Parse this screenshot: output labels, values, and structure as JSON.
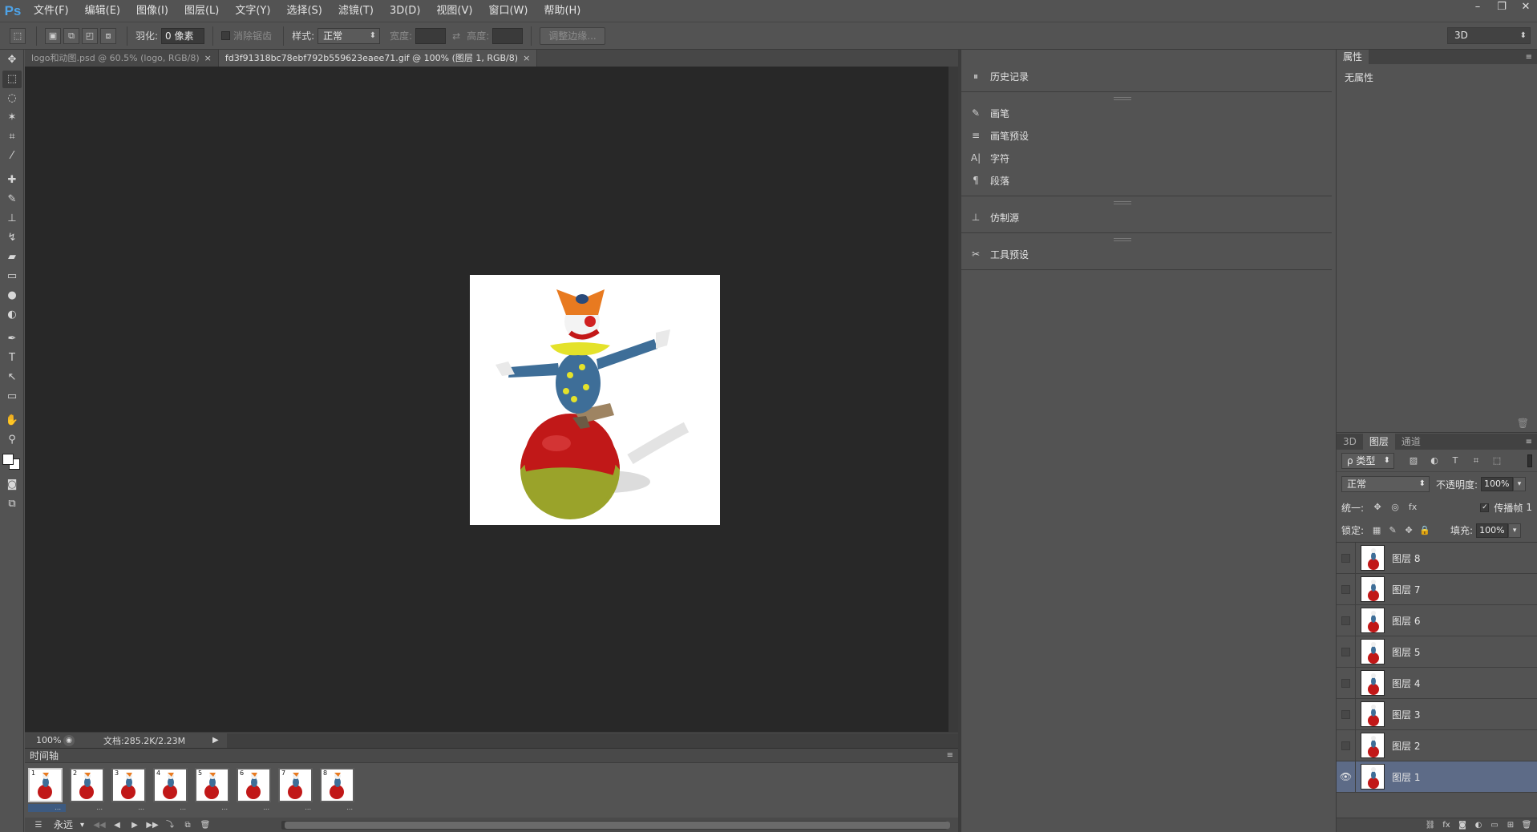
{
  "app": {
    "logo": "Ps",
    "menu": [
      "文件(F)",
      "编辑(E)",
      "图像(I)",
      "图层(L)",
      "文字(Y)",
      "选择(S)",
      "滤镜(T)",
      "3D(D)",
      "视图(V)",
      "窗口(W)",
      "帮助(H)"
    ],
    "window_controls": {
      "minimize": "–",
      "restore": "❐",
      "close": "✕"
    }
  },
  "options": {
    "feather_label": "羽化:",
    "feather_value": "0 像素",
    "antialias_label": "消除锯齿",
    "style_label": "样式:",
    "style_value": "正常",
    "width_label": "宽度:",
    "height_label": "高度:",
    "refine_edge": "调整边缘...",
    "workspace": "3D"
  },
  "tabs": [
    {
      "title": "logo和动图.psd @ 60.5% (logo, RGB/8)",
      "close": "×",
      "active": false
    },
    {
      "title": "fd3f91318bc78ebf792b559623eaee71.gif @ 100% (图层 1, RGB/8)",
      "close": "×",
      "active": true
    }
  ],
  "status": {
    "zoom": "100%",
    "doc_info": "文档:285.2K/2.23M",
    "arrow": "▶"
  },
  "timeline": {
    "title": "时间轴",
    "frames": [
      {
        "number": "1",
        "delay": "..."
      },
      {
        "number": "2",
        "delay": "..."
      },
      {
        "number": "3",
        "delay": "..."
      },
      {
        "number": "4",
        "delay": "..."
      },
      {
        "number": "5",
        "delay": "..."
      },
      {
        "number": "6",
        "delay": "..."
      },
      {
        "number": "7",
        "delay": "..."
      },
      {
        "number": "8",
        "delay": "..."
      }
    ],
    "loop": "永远",
    "selected_frame": 1
  },
  "mid_panels": [
    {
      "items": [
        {
          "icon": "history-icon",
          "glyph": "⏸",
          "label": "历史记录"
        }
      ]
    },
    {
      "items": [
        {
          "icon": "brush-icon",
          "glyph": "✎",
          "label": "画笔"
        },
        {
          "icon": "brush-preset-icon",
          "glyph": "≡",
          "label": "画笔预设"
        },
        {
          "icon": "character-icon",
          "glyph": "A|",
          "label": "字符"
        },
        {
          "icon": "paragraph-icon",
          "glyph": "¶",
          "label": "段落"
        }
      ]
    },
    {
      "items": [
        {
          "icon": "clone-source-icon",
          "glyph": "⊥",
          "label": "仿制源"
        }
      ]
    },
    {
      "items": [
        {
          "icon": "tool-presets-icon",
          "glyph": "✂",
          "label": "工具预设"
        }
      ]
    }
  ],
  "properties": {
    "tab": "属性",
    "empty_text": "无属性"
  },
  "layers_panel": {
    "tabs": [
      "3D",
      "图层",
      "通道"
    ],
    "active_tab": "图层",
    "filter_label": "ρ 类型",
    "blend_mode": "正常",
    "opacity_label": "不透明度:",
    "opacity_value": "100%",
    "unify_label": "统一:",
    "propagate_label": "传播帧",
    "propagate_value": "1",
    "lock_label": "锁定:",
    "fill_label": "填充:",
    "fill_value": "100%",
    "layers": [
      {
        "name": "图层 8",
        "visible": false
      },
      {
        "name": "图层 7",
        "visible": false
      },
      {
        "name": "图层 6",
        "visible": false
      },
      {
        "name": "图层 5",
        "visible": false
      },
      {
        "name": "图层 4",
        "visible": false
      },
      {
        "name": "图层 3",
        "visible": false
      },
      {
        "name": "图层 2",
        "visible": false
      },
      {
        "name": "图层 1",
        "visible": true
      }
    ]
  },
  "colors": {
    "accent": "#4ea3e8",
    "selected_layer": "#5d6b87",
    "canvas_bg": "#282828",
    "panel_bg": "#535353"
  }
}
